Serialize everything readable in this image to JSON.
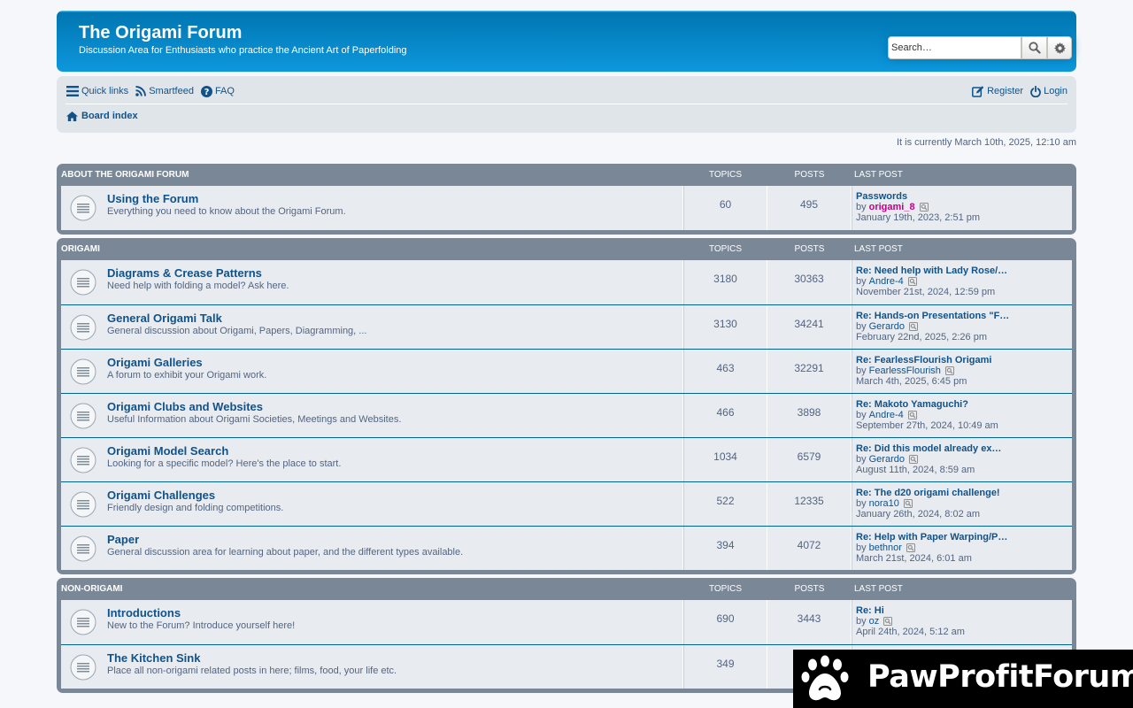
{
  "header": {
    "site_title": "The Origami Forum",
    "site_description": "Discussion Area for Enthusiasts who practice the Ancient Art of Paperfolding",
    "search_placeholder": "Search…"
  },
  "navbar": {
    "quick_links": "Quick links",
    "smartfeed": "Smartfeed",
    "faq": "FAQ",
    "register": "Register",
    "login": "Login",
    "breadcrumb": "Board index"
  },
  "current_time": "It is currently March 10th, 2025, 12:10 am",
  "columns": {
    "topics": "TOPICS",
    "posts": "POSTS",
    "last_post": "LAST POST"
  },
  "categories": [
    {
      "title": "ABOUT THE ORIGAMI FORUM",
      "forums": [
        {
          "name": "Using the Forum",
          "desc": "Everything you need to know about the Origami Forum.",
          "topics": "60",
          "posts": "495",
          "last_title": "Passwords",
          "by": "by",
          "last_user": "origami_8",
          "last_date": "January 19th, 2023, 2:51 pm"
        }
      ]
    },
    {
      "title": "ORIGAMI",
      "forums": [
        {
          "name": "Diagrams & Crease Patterns",
          "desc": "Need help with folding a model? Ask here.",
          "topics": "3180",
          "posts": "30363",
          "last_title": "Re: Need help with Lady Rose/…",
          "by": "by",
          "last_user": "Andre-4",
          "last_date": "November 21st, 2024, 12:59 pm"
        },
        {
          "name": "General Origami Talk",
          "desc": "General discussion about Origami, Papers, Diagramming, ...",
          "topics": "3130",
          "posts": "34241",
          "last_title": "Re: Hands-on Presentations \"F…",
          "by": "by",
          "last_user": "Gerardo",
          "last_date": "February 22nd, 2025, 2:26 pm"
        },
        {
          "name": "Origami Galleries",
          "desc": "A forum to exhibit your Origami work.",
          "topics": "463",
          "posts": "32291",
          "last_title": "Re: FearlessFlourish Origami",
          "by": "by",
          "last_user": "FearlessFlourish",
          "last_date": "March 4th, 2025, 6:45 pm"
        },
        {
          "name": "Origami Clubs and Websites",
          "desc": "Useful Information about Origami Societies, Meetings and Websites.",
          "topics": "466",
          "posts": "3898",
          "last_title": "Re: Makoto Yamaguchi?",
          "by": "by",
          "last_user": "Andre-4",
          "last_date": "September 27th, 2024, 10:49 am"
        },
        {
          "name": "Origami Model Search",
          "desc": "Looking for a specific model? Here's the place to start.",
          "topics": "1034",
          "posts": "6579",
          "last_title": "Re: Did this model already ex…",
          "by": "by",
          "last_user": "Gerardo",
          "last_date": "August 11th, 2024, 8:59 am"
        },
        {
          "name": "Origami Challenges",
          "desc": "Friendly design and folding competitions.",
          "topics": "522",
          "posts": "12335",
          "last_title": "Re: The d20 origami challenge!",
          "by": "by",
          "last_user": "nora10",
          "last_date": "January 26th, 2024, 8:02 am"
        },
        {
          "name": "Paper",
          "desc": "General discussion area for learning about paper, and the different types available.",
          "topics": "394",
          "posts": "4072",
          "last_title": "Re: Help with Paper Warping/P…",
          "by": "by",
          "last_user": "bethnor",
          "last_date": "March 21st, 2024, 6:01 am"
        }
      ]
    },
    {
      "title": "NON-ORIGAMI",
      "forums": [
        {
          "name": "Introductions",
          "desc": "New to the Forum? Introduce yourself here!",
          "topics": "690",
          "posts": "3443",
          "last_title": "Re: Hi",
          "by": "by",
          "last_user": "oz",
          "last_date": "April 24th, 2024, 5:12 am"
        },
        {
          "name": "The Kitchen Sink",
          "desc": "Place all non-origami related posts in here; films, food, your life etc.",
          "topics": "349",
          "posts": "",
          "last_title": "",
          "by": "",
          "last_user": "",
          "last_date": ""
        }
      ]
    }
  ],
  "promo": {
    "text": "PawProfitForum"
  },
  "colors": {
    "header_blue": "#12a3eb",
    "link_blue": "#105289",
    "admin_pink": "#c0008a",
    "category_bar": "#7a8796"
  }
}
